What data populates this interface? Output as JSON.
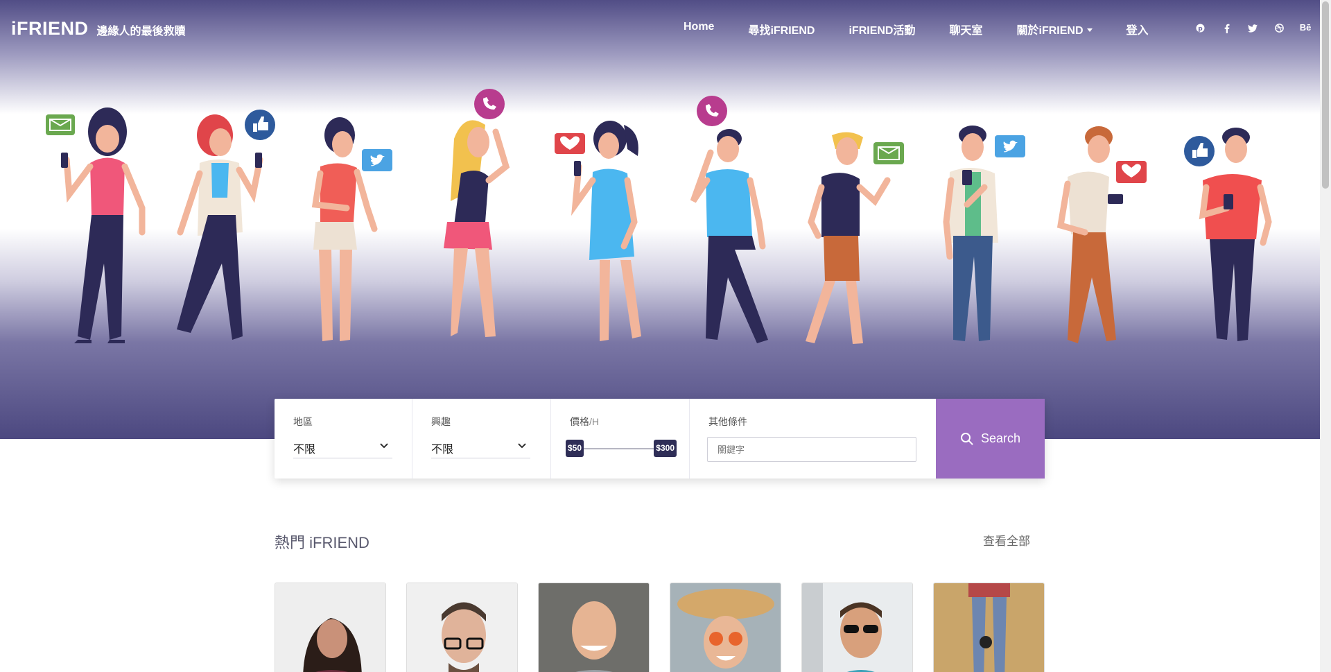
{
  "brand": {
    "name": "iFRIEND",
    "tagline": "邊緣人的最後救贖"
  },
  "nav": {
    "items": [
      {
        "label": "Home"
      },
      {
        "label": "尋找iFRIEND"
      },
      {
        "label": "iFRIEND活動"
      },
      {
        "label": "聊天室"
      },
      {
        "label": "關於iFRIEND"
      },
      {
        "label": "登入"
      }
    ],
    "social": [
      "pinterest-icon",
      "facebook-icon",
      "twitter-icon",
      "dribbble-icon",
      "behance-icon"
    ],
    "behance_text": "Bē"
  },
  "search": {
    "region": {
      "label": "地區",
      "value": "不限"
    },
    "interest": {
      "label": "興趣",
      "value": "不限"
    },
    "price": {
      "label": "價格",
      "unit": "/H",
      "min": "$50",
      "max": "$300"
    },
    "other": {
      "label": "其他條件",
      "placeholder": "關鍵字"
    },
    "button": "Search"
  },
  "section": {
    "title": "熱門 iFRIEND",
    "view_all": "查看全部"
  },
  "colors": {
    "accent": "#9a6cc0",
    "hero_dark": "#4c4880",
    "pill": "#2f2e57"
  }
}
